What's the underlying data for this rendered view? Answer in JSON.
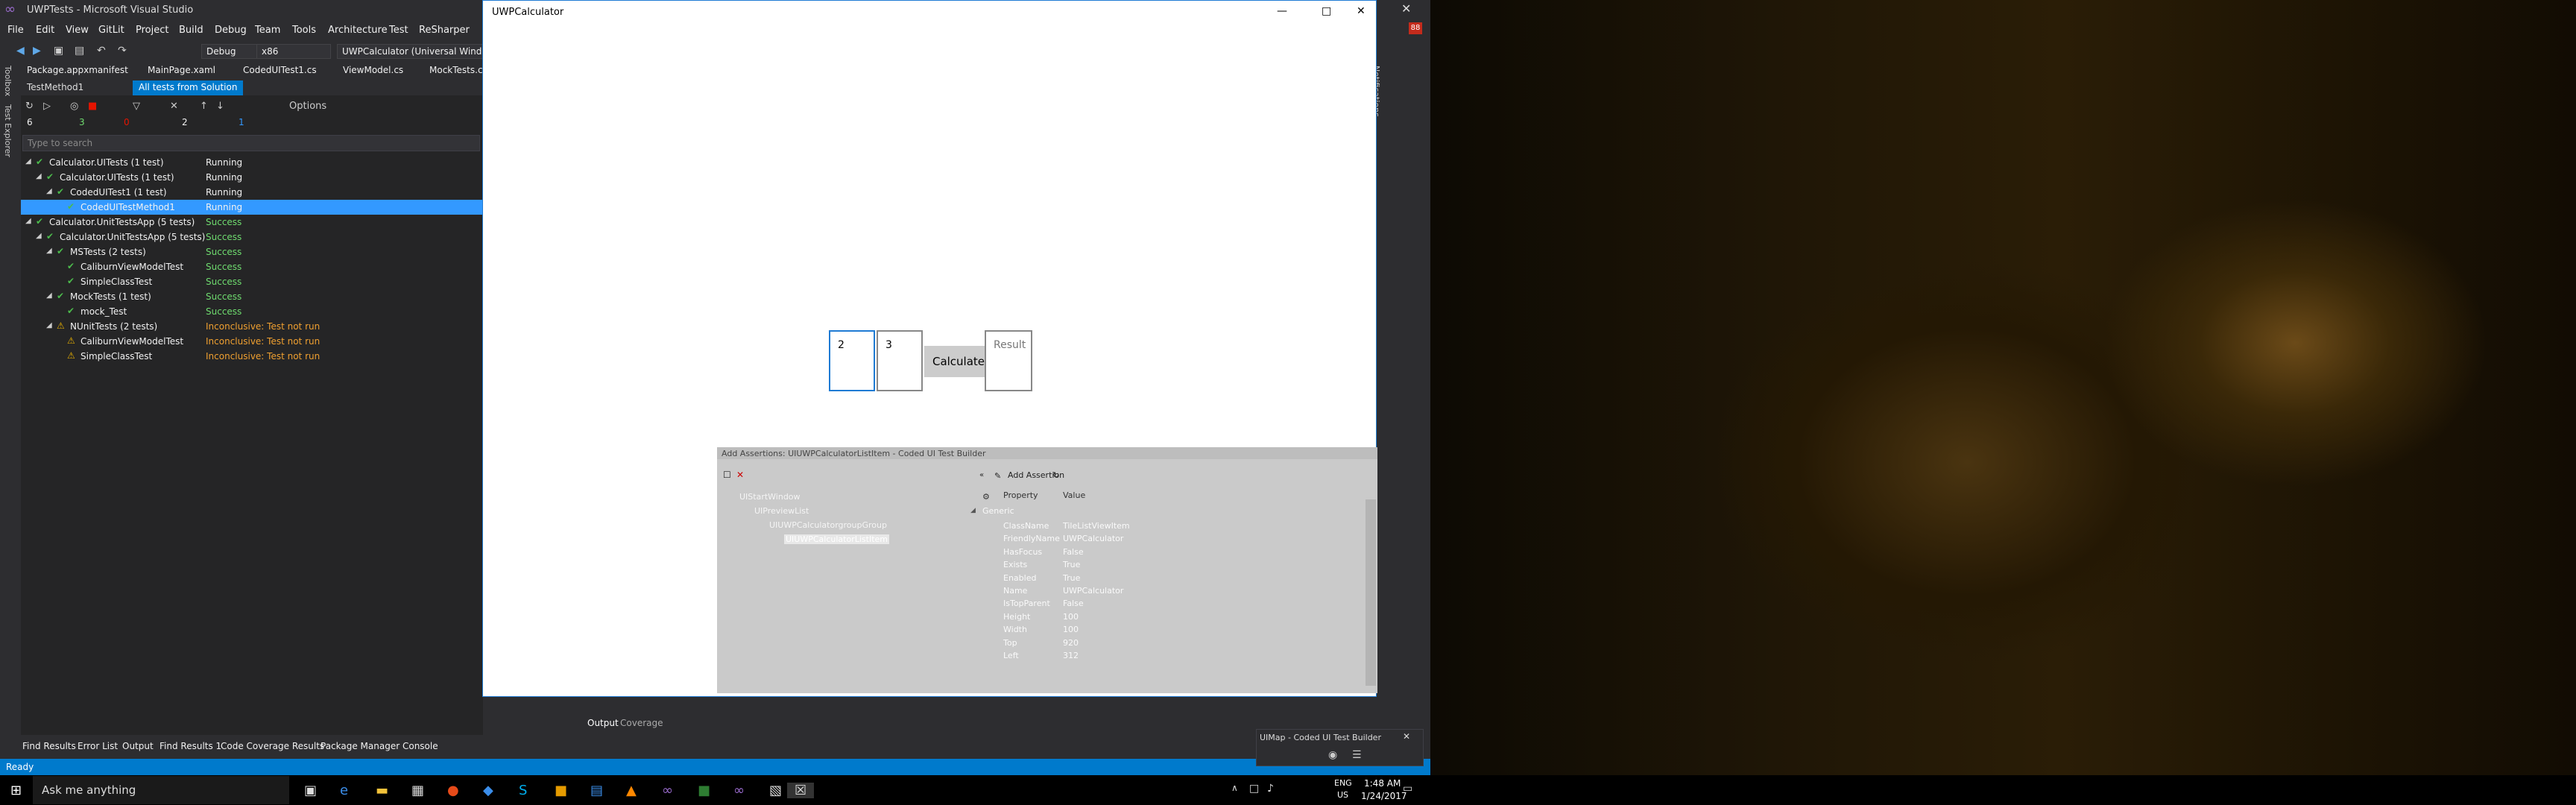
{
  "vs": {
    "window_title": "UWPTests - Microsoft Visual Studio",
    "menu": [
      "File",
      "Edit",
      "View",
      "GitLit",
      "Project",
      "Build",
      "Debug",
      "Team",
      "Tools",
      "Architecture",
      "Test",
      "ReSharper"
    ],
    "toolbar": {
      "config": "Debug",
      "platform": "x86",
      "target": "UWPCalculator (Universal Windows)"
    },
    "doc_tabs": [
      "Package.appxmanifest",
      "MainPage.xaml",
      "CodedUITest1.cs",
      "ViewModel.cs",
      "MockTests.cs"
    ],
    "side_labels": [
      "Toolbox",
      "Test Explorer"
    ],
    "explorer_tabs": [
      "TestMethod1",
      "All tests from Solution"
    ],
    "options_label": "Options",
    "counts": {
      "total": "6",
      "passed": "3",
      "failed": "0",
      "skipped": "2",
      "running": "1"
    },
    "search_placeholder": "Type to search",
    "tests": [
      {
        "name": "Calculator.UITests (1 test)",
        "status": "Running",
        "kind": "run"
      },
      {
        "name": "Calculator.UITests (1 test)",
        "status": "Running",
        "kind": "run"
      },
      {
        "name": "CodedUITest1 (1 test)",
        "status": "Running",
        "kind": "run"
      },
      {
        "name": "CodedUITestMethod1",
        "status": "Running",
        "kind": "run"
      },
      {
        "name": "Calculator.UnitTestsApp (5 tests)",
        "status": "Success",
        "kind": "ok"
      },
      {
        "name": "Calculator.UnitTestsApp (5 tests)",
        "status": "Success",
        "kind": "ok"
      },
      {
        "name": "MSTests (2 tests)",
        "status": "Success",
        "kind": "ok"
      },
      {
        "name": "CaliburnViewModelTest",
        "status": "Success",
        "kind": "ok"
      },
      {
        "name": "SimpleClassTest",
        "status": "Success",
        "kind": "ok"
      },
      {
        "name": "MockTests (1 test)",
        "status": "Success",
        "kind": "ok"
      },
      {
        "name": "mock_Test",
        "status": "Success",
        "kind": "ok"
      },
      {
        "name": "NUnitTests (2 tests)",
        "status": "Inconclusive: Test not run",
        "kind": "warn"
      },
      {
        "name": "CaliburnViewModelTest",
        "status": "Inconclusive: Test not run",
        "kind": "warn"
      },
      {
        "name": "SimpleClassTest",
        "status": "Inconclusive: Test not run",
        "kind": "warn"
      }
    ],
    "bottom_tabs": [
      "Find Results",
      "Error List",
      "Output",
      "Find Results 1",
      "Code Coverage Results",
      "Package Manager Console"
    ],
    "output_tabs": [
      "Output",
      "Coverage"
    ],
    "status": "Ready",
    "notifications_label": "Notifications",
    "badge": "88"
  },
  "app": {
    "title": "UWPCalculator",
    "input1": "2",
    "input2": "3",
    "button": "Calculate",
    "result": "Result"
  },
  "cuitb": {
    "title": "Add Assertions: UIUWPCalculatorListItem - Coded UI Test Builder",
    "add_assertion": "Add Assertion",
    "tree": [
      "UIStartWindow",
      "UIPreviewList",
      "UIUWPCalculatorgroupGroup",
      "UIUWPCalculatorListItem"
    ],
    "col_property": "Property",
    "col_value": "Value",
    "group": "Generic",
    "props": [
      {
        "k": "ClassName",
        "v": "TileListViewItem"
      },
      {
        "k": "FriendlyName",
        "v": "UWPCalculator"
      },
      {
        "k": "HasFocus",
        "v": "False"
      },
      {
        "k": "Exists",
        "v": "True"
      },
      {
        "k": "Enabled",
        "v": "True"
      },
      {
        "k": "Name",
        "v": "UWPCalculator"
      },
      {
        "k": "IsTopParent",
        "v": "False"
      },
      {
        "k": "Height",
        "v": "100"
      },
      {
        "k": "Width",
        "v": "100"
      },
      {
        "k": "Top",
        "v": "920"
      },
      {
        "k": "Left",
        "v": "312"
      }
    ]
  },
  "uimap": {
    "title": "UIMap - Coded UI Test Builder"
  },
  "taskbar": {
    "search": "Ask me anything",
    "lang": "ENG",
    "region": "US",
    "time": "1:48 AM",
    "date": "1/24/2017"
  }
}
